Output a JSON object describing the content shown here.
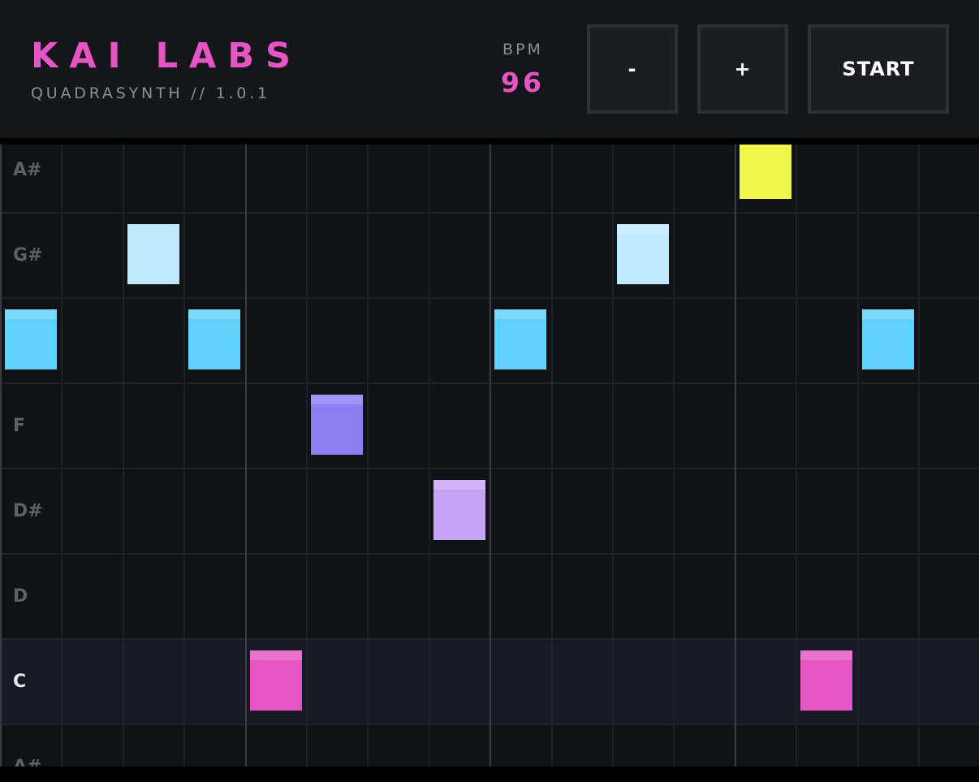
{
  "header": {
    "brand": "KAI LABS",
    "subtitle": "QUADRASYNTH // 1.0.1",
    "bpm_label": "BPM",
    "bpm_value": "96",
    "minus_label": "-",
    "plus_label": "+",
    "start_label": "START"
  },
  "colors": {
    "accent": "#e754c4",
    "note_a_sharp": "#eef74a",
    "note_g_sharp": "#bfe8fd",
    "note_g": "#5fd1fb",
    "note_f": "#8a7ef3",
    "note_d_sharp": "#c6a3f7",
    "note_c": "#e754c4"
  },
  "sequencer": {
    "steps": 16,
    "beat_every": 4,
    "highlight_row": 6,
    "rows": [
      {
        "label": "A#",
        "color": "#eef74a",
        "active_steps": [
          12
        ],
        "style": "clip"
      },
      {
        "label": "G#",
        "color": "#bfe8fd",
        "active_steps": [
          2,
          10
        ],
        "faded_steps": [
          2
        ]
      },
      {
        "label": "",
        "color": "#5fd1fb",
        "active_steps": [
          0,
          3,
          8,
          14
        ]
      },
      {
        "label": "F",
        "color": "#8a7ef3",
        "active_steps": [
          5
        ]
      },
      {
        "label": "D#",
        "color": "#c6a3f7",
        "active_steps": [
          7
        ]
      },
      {
        "label": "D",
        "color": "#8a7ef3",
        "active_steps": []
      },
      {
        "label": "C",
        "color": "#e754c4",
        "active_steps": [
          4,
          13
        ]
      },
      {
        "label": "A#",
        "color": "#eef74a",
        "active_steps": []
      }
    ]
  }
}
